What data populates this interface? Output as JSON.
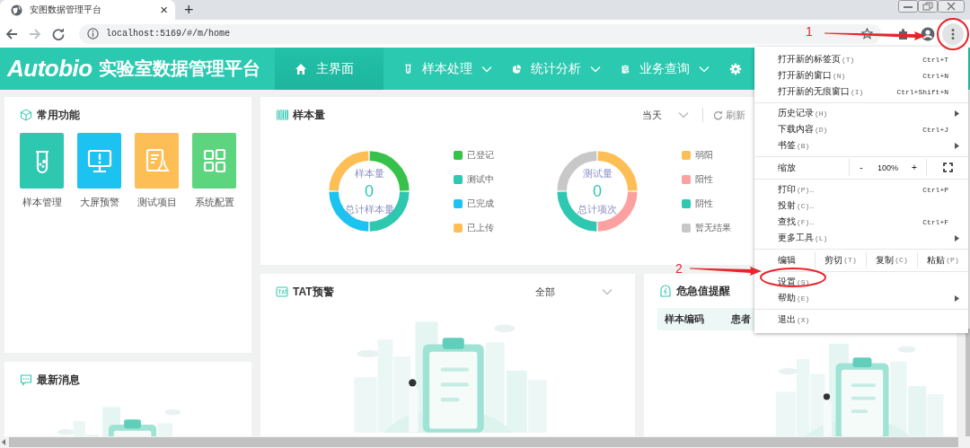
{
  "browser": {
    "tab": {
      "title": "安图数据管理平台",
      "close": "×"
    },
    "new_tab": "+",
    "url": "localhost:5169/#/m/home"
  },
  "app": {
    "brand": "Autobio",
    "title": "实验室数据管理平台",
    "nav": [
      {
        "label": "主界面",
        "selected": true,
        "dropdown": false
      },
      {
        "label": "样本处理",
        "selected": false,
        "dropdown": true
      },
      {
        "label": "统计分析",
        "selected": false,
        "dropdown": true
      },
      {
        "label": "业务查询",
        "selected": false,
        "dropdown": true
      },
      {
        "selected": false,
        "dropdown": false
      }
    ]
  },
  "quick_functions": {
    "title": "常用功能",
    "items": [
      {
        "label": "样本管理",
        "color": "#2ec7b0"
      },
      {
        "label": "大屏预警",
        "color": "#1dc3f0"
      },
      {
        "label": "测试项目",
        "color": "#fdbf55"
      },
      {
        "label": "系统配置",
        "color": "#5dd57f"
      }
    ]
  },
  "messages": {
    "title": "最新消息"
  },
  "sample_volume": {
    "title": "样本量",
    "period": "当天",
    "refresh": "刷新",
    "donuts": [
      {
        "top": "样本量",
        "value": "0",
        "bottom": "总计样本量",
        "legend": [
          {
            "label": "已登记",
            "color": "#35c14a"
          },
          {
            "label": "测试中",
            "color": "#2ec7b0"
          },
          {
            "label": "已完成",
            "color": "#1dc3f0"
          },
          {
            "label": "已上传",
            "color": "#fdbf55"
          }
        ]
      },
      {
        "top": "测试量",
        "value": "0",
        "bottom": "总计项次",
        "legend": [
          {
            "label": "弱阳",
            "color": "#fdbf55"
          },
          {
            "label": "阳性",
            "color": "#fda0a0"
          },
          {
            "label": "阴性",
            "color": "#2ec7b0"
          },
          {
            "label": "暂无结果",
            "color": "#c8c8c8"
          }
        ]
      }
    ]
  },
  "tat": {
    "title": "TAT预警",
    "filter": "全部"
  },
  "critical": {
    "title": "危急值提醒",
    "columns": [
      "样本编码",
      "患者"
    ]
  },
  "menu": {
    "sections": [
      [
        {
          "kind": "item",
          "label": "打开新的标签页",
          "key": "(T)",
          "shortcut": "Ctrl+T",
          "submenu": false
        },
        {
          "kind": "item",
          "label": "打开新的窗口",
          "key": "(N)",
          "shortcut": "Ctrl+N",
          "submenu": false
        },
        {
          "kind": "item",
          "label": "打开新的无痕窗口",
          "key": "(I)",
          "shortcut": "Ctrl+Shift+N",
          "submenu": false
        }
      ],
      [
        {
          "kind": "item",
          "label": "历史记录",
          "key": "(H)",
          "submenu": true
        },
        {
          "kind": "item",
          "label": "下载内容",
          "key": "(D)",
          "shortcut": "Ctrl+J",
          "submenu": false
        },
        {
          "kind": "item",
          "label": "书签",
          "key": "(B)",
          "submenu": true
        }
      ],
      [
        {
          "kind": "zoom",
          "label": "缩放",
          "minus": "-",
          "value": "100%",
          "plus": "+"
        }
      ],
      [
        {
          "kind": "item",
          "label": "打印",
          "key": "(P)…",
          "shortcut": "Ctrl+P",
          "submenu": false
        },
        {
          "kind": "item",
          "label": "投射",
          "key": "(C)…",
          "submenu": false
        },
        {
          "kind": "item",
          "label": "查找",
          "key": "(F)…",
          "shortcut": "Ctrl+F",
          "submenu": false
        },
        {
          "kind": "item",
          "label": "更多工具",
          "key": "(L)",
          "submenu": true
        }
      ],
      [
        {
          "kind": "edit",
          "label": "编辑",
          "buttons": [
            {
              "label": "剪切",
              "key": "(T)"
            },
            {
              "label": "复制",
              "key": "(C)"
            },
            {
              "label": "粘贴",
              "key": "(P)"
            }
          ]
        }
      ],
      [
        {
          "kind": "item",
          "label": "设置",
          "key": "(S)",
          "submenu": false
        },
        {
          "kind": "item",
          "label": "帮助",
          "key": "(E)",
          "submenu": true
        }
      ],
      [
        {
          "kind": "item",
          "label": "退出",
          "key": "(X)",
          "submenu": false
        }
      ]
    ]
  },
  "annotations": [
    {
      "label": "1"
    },
    {
      "label": "2"
    }
  ]
}
